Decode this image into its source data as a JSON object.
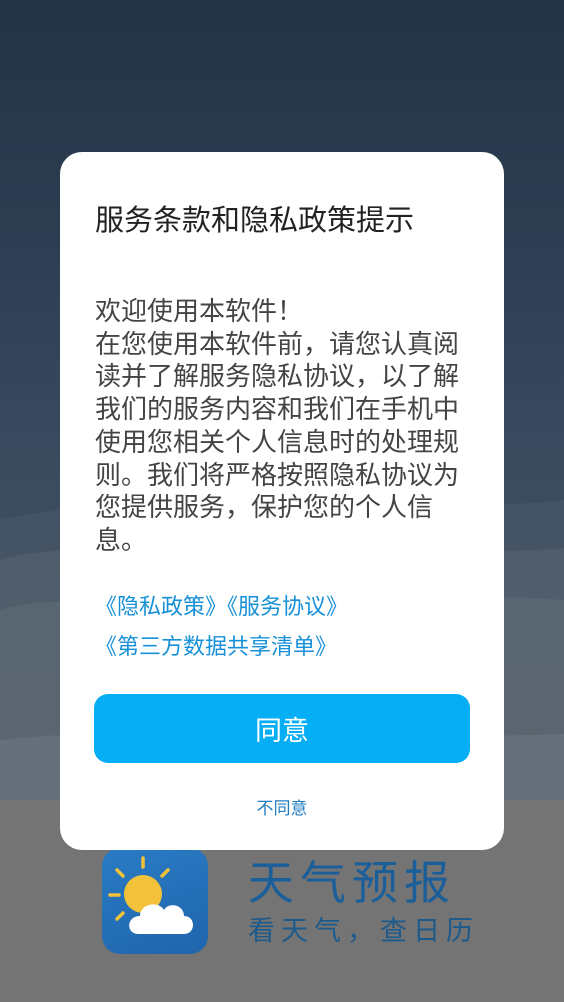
{
  "dialog": {
    "title": "服务条款和隐私政策提示",
    "body_lines": [
      "欢迎使用本软件！",
      "在您使用本软件前，请您认真阅读并了解服务隐私协议，以了解我们的服务内容和我们在手机中使用您相关个人信息时的处理规则。我们将严格按照隐私协议为您提供服务，保护您的个人信息。"
    ],
    "links": {
      "privacy_policy": "《隐私政策》",
      "service_agreement": "《服务协议》",
      "third_party_list": "《第三方数据共享清单》"
    },
    "agree_label": "同意",
    "disagree_label": "不同意"
  },
  "splash": {
    "app_name": "天气预报",
    "slogan": "看天气，查日历",
    "icon": "weather-sun-cloud-icon"
  },
  "colors": {
    "accent": "#06aef5",
    "link": "#1690d8",
    "brand_text": "#1a5e9a"
  }
}
